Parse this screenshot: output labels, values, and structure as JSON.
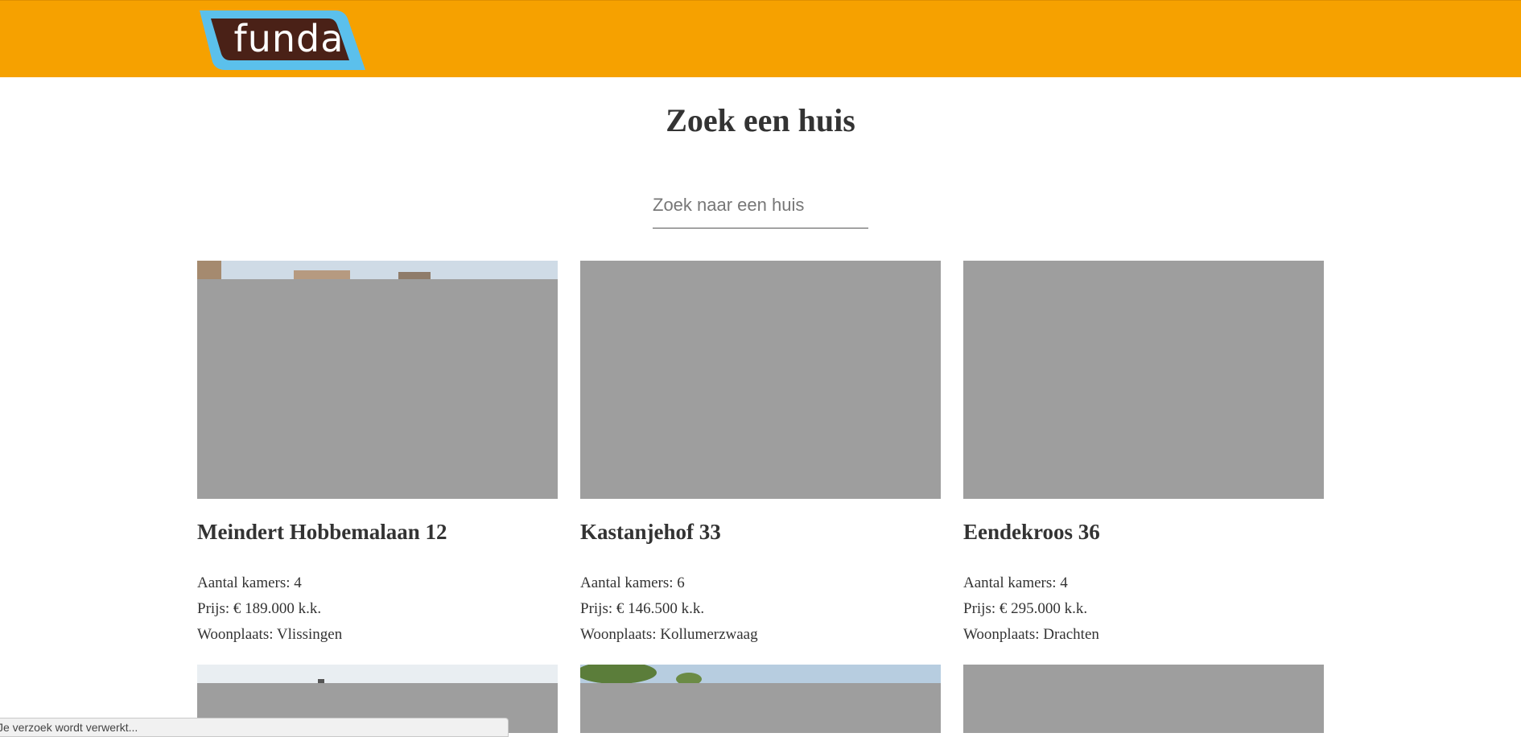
{
  "header": {
    "logo_text": "funda",
    "colors": {
      "bar": "#f6a100",
      "logo_fill": "#4a2117",
      "logo_outline": "#5bc0ec"
    }
  },
  "main": {
    "title": "Zoek een huis",
    "search": {
      "placeholder": "Zoek naar een huis",
      "value": ""
    }
  },
  "listings": [
    {
      "address": "Meindert Hobbemalaan 12",
      "rooms": "Aantal kamers: 4",
      "price": "Prijs: € 189.000 k.k.",
      "city": "Woonplaats: Vlissingen"
    },
    {
      "address": "Kastanjehof 33",
      "rooms": "Aantal kamers: 6",
      "price": "Prijs: € 146.500 k.k.",
      "city": "Woonplaats: Kollumerzwaag"
    },
    {
      "address": "Eendekroos 36",
      "rooms": "Aantal kamers: 4",
      "price": "Prijs: € 295.000 k.k.",
      "city": "Woonplaats: Drachten"
    }
  ],
  "status_bar": {
    "text": "Je verzoek wordt verwerkt..."
  }
}
